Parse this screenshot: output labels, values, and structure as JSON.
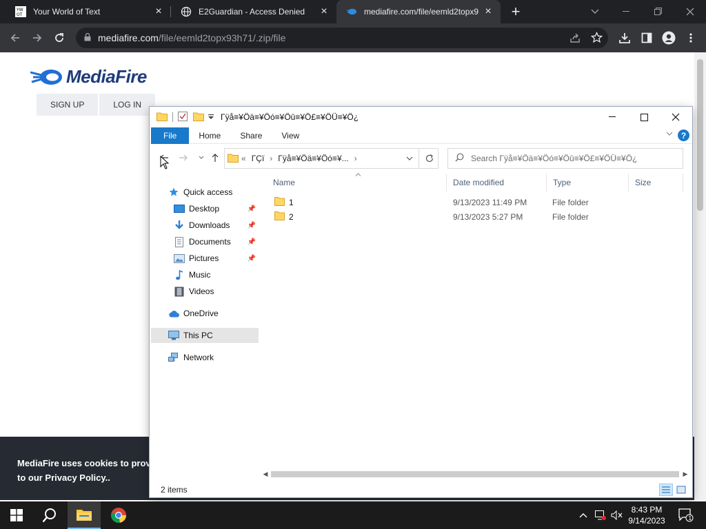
{
  "browser": {
    "tabs": [
      {
        "title": "Your World of Text",
        "active": false,
        "favicon": "ywot-icon"
      },
      {
        "title": "E2Guardian - Access Denied",
        "active": false,
        "favicon": "globe-icon"
      },
      {
        "title": "mediafire.com/file/eemld2topx9",
        "active": true,
        "favicon": "mediafire-icon"
      }
    ],
    "url_host": "mediafire.com",
    "url_path": "/file/eemld2topx93h71/.zip/file",
    "colors": {
      "frame": "#202124",
      "toolbar": "#35363a"
    }
  },
  "page": {
    "logo_text": "MediaFire",
    "nav": {
      "signup": "SIGN UP",
      "login": "LOG IN"
    },
    "cookie_line1": "MediaFire uses cookies to provide",
    "cookie_line2": "to our Privacy Policy.."
  },
  "explorer": {
    "title": "Γÿå≡¥Öä≡¥Öó≡¥Öû≡¥Ö£≡¥ÖÜ≡¥Ö¿",
    "ribbon": {
      "file": "File",
      "home": "Home",
      "share": "Share",
      "view": "View"
    },
    "address": {
      "prefix": "«",
      "crumb1": "ΓÇï",
      "crumb2": "Γÿå≡¥Öä≡¥Öó≡¥..."
    },
    "search_placeholder": "Search Γÿå≡¥Öä≡¥Öó≡¥Öû≡¥Ö£≡¥ÖÜ≡¥Ö¿",
    "nav": {
      "quick_access": "Quick access",
      "desktop": "Desktop",
      "downloads": "Downloads",
      "documents": "Documents",
      "pictures": "Pictures",
      "music": "Music",
      "videos": "Videos",
      "onedrive": "OneDrive",
      "this_pc": "This PC",
      "network": "Network"
    },
    "columns": {
      "name": "Name",
      "date": "Date modified",
      "type": "Type",
      "size": "Size"
    },
    "files": [
      {
        "name": "1",
        "date": "9/13/2023 11:49 PM",
        "type": "File folder"
      },
      {
        "name": "2",
        "date": "9/13/2023 5:27 PM",
        "type": "File folder"
      }
    ],
    "status": "2 items"
  },
  "taskbar": {
    "time": "8:43 PM",
    "date": "9/14/2023",
    "notification_count": "1"
  }
}
